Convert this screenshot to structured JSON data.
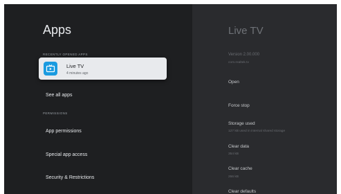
{
  "apps_panel": {
    "title": "Apps",
    "recent_label": "RECENTLY OPENED APPS",
    "selected_app": {
      "name": "Live TV",
      "last_used": "4 minutes ago",
      "icon": "tv-icon"
    },
    "see_all": "See all apps",
    "permissions_label": "PERMISSIONS",
    "items": [
      "App permissions",
      "Special app access",
      "Security & Restrictions"
    ]
  },
  "detail_panel": {
    "title": "Live TV",
    "version": "Version 2.00.000",
    "package": "com.realtek.tv",
    "open": "Open",
    "force_stop": "Force stop",
    "storage_title": "Storage used",
    "storage_desc": "127 kB used in internal shared storage",
    "clear_data_title": "Clear data",
    "clear_data_size": "354 kB",
    "clear_cache_title": "Clear cache",
    "clear_cache_size": "266 kB",
    "clear_defaults_title": "Clear defaults"
  },
  "colors": {
    "background_left": "#1e1f21",
    "background_right": "#2a2b2e",
    "card": "#e8eaed",
    "app_icon": "#1a9be0"
  }
}
